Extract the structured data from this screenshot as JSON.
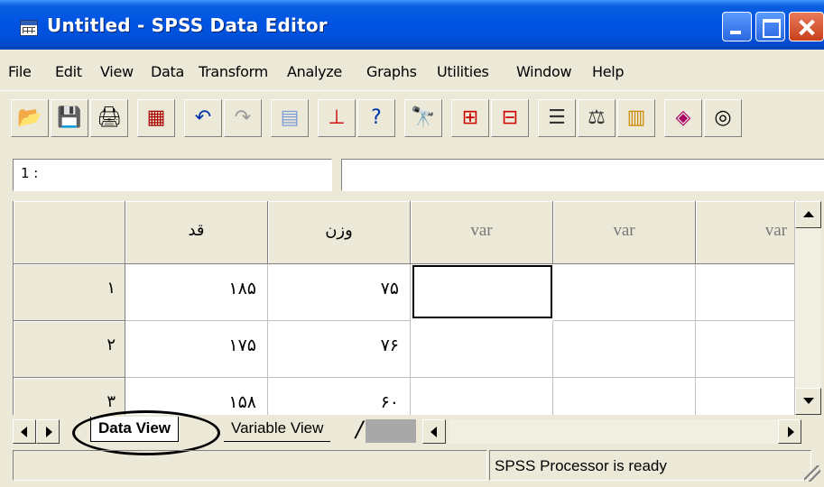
{
  "window": {
    "title": "Untitled - SPSS Data Editor",
    "icon": "data-editor-grid-icon"
  },
  "menu": [
    "File",
    "Edit",
    "View",
    "Data",
    "Transform",
    "Analyze",
    "Graphs",
    "Utilities",
    "Window",
    "Help"
  ],
  "toolbar": {
    "icons": [
      "open-file-icon",
      "save-icon",
      "print-icon",
      "dialog-recall-icon",
      "undo-icon",
      "redo-icon",
      "goto-chart-icon",
      "goto-case-icon",
      "variables-icon",
      "find-icon",
      "insert-cases-icon",
      "insert-variable-icon",
      "split-file-icon",
      "weight-cases-icon",
      "select-cases-icon",
      "value-labels-icon",
      "use-sets-icon"
    ]
  },
  "cell_indicator": {
    "ref": "1 :",
    "value": ""
  },
  "grid": {
    "columns": [
      "قد",
      "وزن",
      "var",
      "var",
      "var"
    ],
    "rows": [
      {
        "num": "۱",
        "cells": [
          "۱۸۵",
          "۷۵",
          "",
          "",
          ""
        ]
      },
      {
        "num": "۲",
        "cells": [
          "۱۷۵",
          "۷۶",
          "",
          "",
          ""
        ]
      },
      {
        "num": "۳",
        "cells": [
          "۱۵۸",
          "۶۰",
          "",
          "",
          ""
        ]
      }
    ]
  },
  "tabs": {
    "data_view": "Data View",
    "variable_view": "Variable View"
  },
  "status": {
    "text": "SPSS Processor  is ready"
  },
  "colors": {
    "titlebar": "#0054e3",
    "chrome": "#ece9d8",
    "close_button": "#c8401c"
  }
}
